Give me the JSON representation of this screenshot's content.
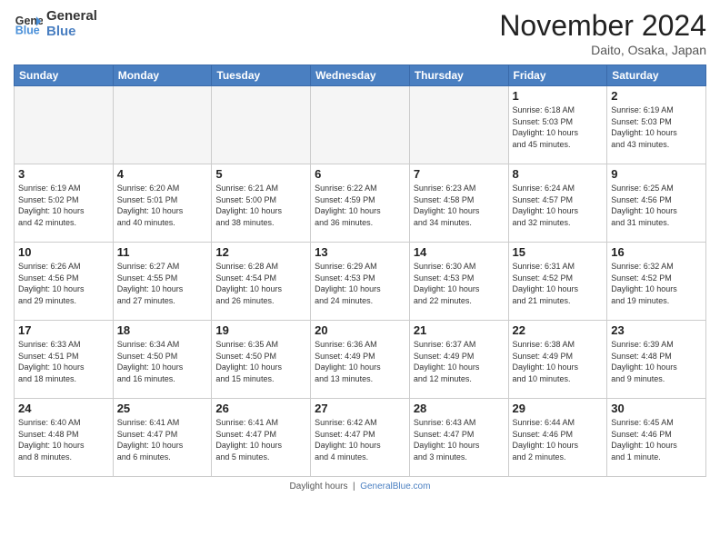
{
  "header": {
    "logo_line1": "General",
    "logo_line2": "Blue",
    "month_title": "November 2024",
    "location": "Daito, Osaka, Japan"
  },
  "weekdays": [
    "Sunday",
    "Monday",
    "Tuesday",
    "Wednesday",
    "Thursday",
    "Friday",
    "Saturday"
  ],
  "weeks": [
    [
      {
        "day": "",
        "info": ""
      },
      {
        "day": "",
        "info": ""
      },
      {
        "day": "",
        "info": ""
      },
      {
        "day": "",
        "info": ""
      },
      {
        "day": "",
        "info": ""
      },
      {
        "day": "1",
        "info": "Sunrise: 6:18 AM\nSunset: 5:03 PM\nDaylight: 10 hours\nand 45 minutes."
      },
      {
        "day": "2",
        "info": "Sunrise: 6:19 AM\nSunset: 5:03 PM\nDaylight: 10 hours\nand 43 minutes."
      }
    ],
    [
      {
        "day": "3",
        "info": "Sunrise: 6:19 AM\nSunset: 5:02 PM\nDaylight: 10 hours\nand 42 minutes."
      },
      {
        "day": "4",
        "info": "Sunrise: 6:20 AM\nSunset: 5:01 PM\nDaylight: 10 hours\nand 40 minutes."
      },
      {
        "day": "5",
        "info": "Sunrise: 6:21 AM\nSunset: 5:00 PM\nDaylight: 10 hours\nand 38 minutes."
      },
      {
        "day": "6",
        "info": "Sunrise: 6:22 AM\nSunset: 4:59 PM\nDaylight: 10 hours\nand 36 minutes."
      },
      {
        "day": "7",
        "info": "Sunrise: 6:23 AM\nSunset: 4:58 PM\nDaylight: 10 hours\nand 34 minutes."
      },
      {
        "day": "8",
        "info": "Sunrise: 6:24 AM\nSunset: 4:57 PM\nDaylight: 10 hours\nand 32 minutes."
      },
      {
        "day": "9",
        "info": "Sunrise: 6:25 AM\nSunset: 4:56 PM\nDaylight: 10 hours\nand 31 minutes."
      }
    ],
    [
      {
        "day": "10",
        "info": "Sunrise: 6:26 AM\nSunset: 4:56 PM\nDaylight: 10 hours\nand 29 minutes."
      },
      {
        "day": "11",
        "info": "Sunrise: 6:27 AM\nSunset: 4:55 PM\nDaylight: 10 hours\nand 27 minutes."
      },
      {
        "day": "12",
        "info": "Sunrise: 6:28 AM\nSunset: 4:54 PM\nDaylight: 10 hours\nand 26 minutes."
      },
      {
        "day": "13",
        "info": "Sunrise: 6:29 AM\nSunset: 4:53 PM\nDaylight: 10 hours\nand 24 minutes."
      },
      {
        "day": "14",
        "info": "Sunrise: 6:30 AM\nSunset: 4:53 PM\nDaylight: 10 hours\nand 22 minutes."
      },
      {
        "day": "15",
        "info": "Sunrise: 6:31 AM\nSunset: 4:52 PM\nDaylight: 10 hours\nand 21 minutes."
      },
      {
        "day": "16",
        "info": "Sunrise: 6:32 AM\nSunset: 4:52 PM\nDaylight: 10 hours\nand 19 minutes."
      }
    ],
    [
      {
        "day": "17",
        "info": "Sunrise: 6:33 AM\nSunset: 4:51 PM\nDaylight: 10 hours\nand 18 minutes."
      },
      {
        "day": "18",
        "info": "Sunrise: 6:34 AM\nSunset: 4:50 PM\nDaylight: 10 hours\nand 16 minutes."
      },
      {
        "day": "19",
        "info": "Sunrise: 6:35 AM\nSunset: 4:50 PM\nDaylight: 10 hours\nand 15 minutes."
      },
      {
        "day": "20",
        "info": "Sunrise: 6:36 AM\nSunset: 4:49 PM\nDaylight: 10 hours\nand 13 minutes."
      },
      {
        "day": "21",
        "info": "Sunrise: 6:37 AM\nSunset: 4:49 PM\nDaylight: 10 hours\nand 12 minutes."
      },
      {
        "day": "22",
        "info": "Sunrise: 6:38 AM\nSunset: 4:49 PM\nDaylight: 10 hours\nand 10 minutes."
      },
      {
        "day": "23",
        "info": "Sunrise: 6:39 AM\nSunset: 4:48 PM\nDaylight: 10 hours\nand 9 minutes."
      }
    ],
    [
      {
        "day": "24",
        "info": "Sunrise: 6:40 AM\nSunset: 4:48 PM\nDaylight: 10 hours\nand 8 minutes."
      },
      {
        "day": "25",
        "info": "Sunrise: 6:41 AM\nSunset: 4:47 PM\nDaylight: 10 hours\nand 6 minutes."
      },
      {
        "day": "26",
        "info": "Sunrise: 6:41 AM\nSunset: 4:47 PM\nDaylight: 10 hours\nand 5 minutes."
      },
      {
        "day": "27",
        "info": "Sunrise: 6:42 AM\nSunset: 4:47 PM\nDaylight: 10 hours\nand 4 minutes."
      },
      {
        "day": "28",
        "info": "Sunrise: 6:43 AM\nSunset: 4:47 PM\nDaylight: 10 hours\nand 3 minutes."
      },
      {
        "day": "29",
        "info": "Sunrise: 6:44 AM\nSunset: 4:46 PM\nDaylight: 10 hours\nand 2 minutes."
      },
      {
        "day": "30",
        "info": "Sunrise: 6:45 AM\nSunset: 4:46 PM\nDaylight: 10 hours\nand 1 minute."
      }
    ]
  ],
  "footer": {
    "text": "Daylight hours",
    "url_text": "GeneralBlue.com"
  }
}
